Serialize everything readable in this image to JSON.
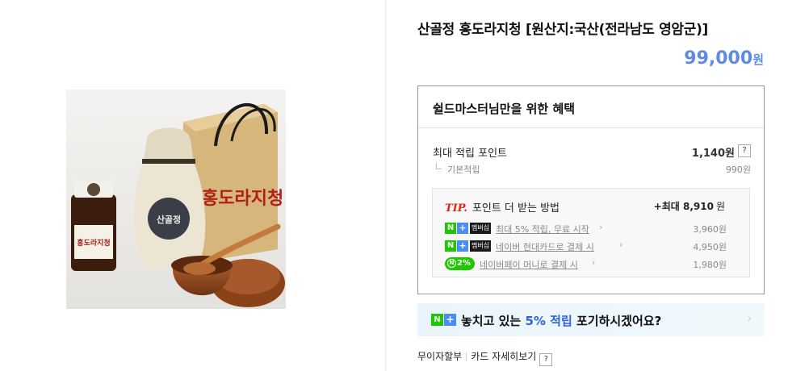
{
  "product": {
    "title": "산골정 홍도라지청 [원산지:국산(전라남도 영암군)]",
    "price": "99,000",
    "price_unit": "원",
    "image_label": "산골정 홍도라지청 상품 이미지",
    "image_texts": {
      "jar_label": "홍도라지청",
      "pouch_label": "산골정",
      "box_label": "홍도라지청"
    }
  },
  "benefit": {
    "heading": "쉴드마스터님만을 위한 혜택",
    "max_points_label": "최대 적립 포인트",
    "max_points_value": "1,140원",
    "help": "?",
    "base_label": "기본적립",
    "base_value": "990원",
    "tip": {
      "tag": "TIP.",
      "label": "포인트 더 받는 방법",
      "max_prefix": "+최대",
      "max_value": "8,910",
      "max_unit": "원",
      "items": [
        {
          "badge_n": "N",
          "badge_plus": "+",
          "badge_member": "멤버십",
          "link": "최대 5% 적립, 무료 시작",
          "amount": "3,960원"
        },
        {
          "badge_n": "N",
          "badge_plus": "+",
          "badge_member": "멤버십",
          "link": "네이버 현대카드로 결제 시",
          "amount": "4,950원"
        },
        {
          "badge_pay_icon": "N",
          "badge_pay_pct": "2%",
          "link": "네이버페이 머니로 결제 시",
          "amount": "1,980원"
        }
      ]
    }
  },
  "banner": {
    "badge_n": "N",
    "badge_plus": "+",
    "text_before": "놓치고 있는 ",
    "text_highlight": "5% 적립",
    "text_after": " 포기하시겠어요?",
    "arrow": "›"
  },
  "footer": {
    "installment": "무이자할부",
    "card_detail": "카드 자세히보기",
    "help": "?"
  },
  "colors": {
    "price": "#5e8be0",
    "naver_green": "#1ec800",
    "plus_blue": "#4b8bf5",
    "tip_red": "#e2231a",
    "highlight_blue": "#2b63e0"
  },
  "icons": {
    "chevron": "chevron-right-icon",
    "help": "help-icon"
  }
}
